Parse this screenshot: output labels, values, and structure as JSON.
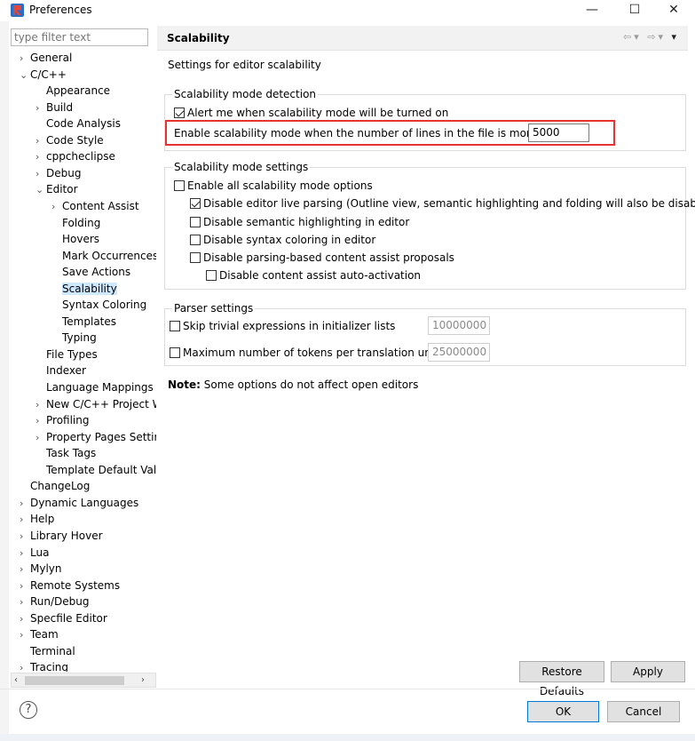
{
  "window": {
    "title": "Preferences",
    "minimize": "—",
    "maximize": "☐",
    "close": "✕"
  },
  "filter": {
    "placeholder": "type filter text"
  },
  "tree": [
    {
      "label": "General",
      "level": 0,
      "arrow": "›"
    },
    {
      "label": "C/C++",
      "level": 0,
      "arrow": "⌄"
    },
    {
      "label": "Appearance",
      "level": 1,
      "arrow": ""
    },
    {
      "label": "Build",
      "level": 1,
      "arrow": "›"
    },
    {
      "label": "Code Analysis",
      "level": 1,
      "arrow": ""
    },
    {
      "label": "Code Style",
      "level": 1,
      "arrow": "›"
    },
    {
      "label": "cppcheclipse",
      "level": 1,
      "arrow": "›"
    },
    {
      "label": "Debug",
      "level": 1,
      "arrow": "›"
    },
    {
      "label": "Editor",
      "level": 1,
      "arrow": "⌄"
    },
    {
      "label": "Content Assist",
      "level": 2,
      "arrow": "›"
    },
    {
      "label": "Folding",
      "level": 2,
      "arrow": ""
    },
    {
      "label": "Hovers",
      "level": 2,
      "arrow": ""
    },
    {
      "label": "Mark Occurrences",
      "level": 2,
      "arrow": ""
    },
    {
      "label": "Save Actions",
      "level": 2,
      "arrow": ""
    },
    {
      "label": "Scalability",
      "level": 2,
      "arrow": "",
      "selected": true
    },
    {
      "label": "Syntax Coloring",
      "level": 2,
      "arrow": ""
    },
    {
      "label": "Templates",
      "level": 2,
      "arrow": ""
    },
    {
      "label": "Typing",
      "level": 2,
      "arrow": ""
    },
    {
      "label": "File Types",
      "level": 1,
      "arrow": ""
    },
    {
      "label": "Indexer",
      "level": 1,
      "arrow": ""
    },
    {
      "label": "Language Mappings",
      "level": 1,
      "arrow": ""
    },
    {
      "label": "New C/C++ Project W",
      "level": 1,
      "arrow": "›"
    },
    {
      "label": "Profiling",
      "level": 1,
      "arrow": "›"
    },
    {
      "label": "Property Pages Settir",
      "level": 1,
      "arrow": "›"
    },
    {
      "label": "Task Tags",
      "level": 1,
      "arrow": ""
    },
    {
      "label": "Template Default Valu",
      "level": 1,
      "arrow": ""
    },
    {
      "label": "ChangeLog",
      "level": 0,
      "arrow": ""
    },
    {
      "label": "Dynamic Languages",
      "level": 0,
      "arrow": "›"
    },
    {
      "label": "Help",
      "level": 0,
      "arrow": "›"
    },
    {
      "label": "Library Hover",
      "level": 0,
      "arrow": "›"
    },
    {
      "label": "Lua",
      "level": 0,
      "arrow": "›"
    },
    {
      "label": "Mylyn",
      "level": 0,
      "arrow": "›"
    },
    {
      "label": "Remote Systems",
      "level": 0,
      "arrow": "›"
    },
    {
      "label": "Run/Debug",
      "level": 0,
      "arrow": "›"
    },
    {
      "label": "Specfile Editor",
      "level": 0,
      "arrow": "›"
    },
    {
      "label": "Team",
      "level": 0,
      "arrow": "›"
    },
    {
      "label": "Terminal",
      "level": 0,
      "arrow": ""
    },
    {
      "label": "Tracing",
      "level": 0,
      "arrow": "›"
    }
  ],
  "panel": {
    "title": "Scalability",
    "nav": {
      "back": "⇦",
      "drop1": "▾",
      "forward": "⇨",
      "drop2": "▾",
      "menu": "▾"
    },
    "description": "Settings for editor scalability",
    "detection": {
      "label": "Scalability mode detection",
      "alert_label": "Alert me when scalability mode will be turned on",
      "alert_checked": true,
      "lines_label": "Enable scalability mode when the number of lines in the file is more than:",
      "lines_value": "5000"
    },
    "settings": {
      "label": "Scalability mode settings",
      "options": [
        {
          "label": "Enable all scalability mode options",
          "checked": false
        },
        {
          "label": "Disable editor live parsing (Outline view, semantic highlighting and folding will also be disabled)",
          "checked": true
        },
        {
          "label": "Disable semantic highlighting in editor",
          "checked": false
        },
        {
          "label": "Disable syntax coloring in editor",
          "checked": false
        },
        {
          "label": "Disable parsing-based content assist proposals",
          "checked": false
        },
        {
          "label": "Disable content assist auto-activation",
          "checked": false
        }
      ]
    },
    "parser": {
      "label": "Parser settings",
      "skip_label": "Skip trivial expressions in initializer lists",
      "skip_value": "10000000",
      "tokens_label": "Maximum number of tokens per translation unit:",
      "tokens_value": "25000000"
    },
    "note_bold": "Note:",
    "note_text": " Some options do not affect open editors"
  },
  "buttons": {
    "restore_defaults": "Restore Defaults",
    "apply": "Apply",
    "ok": "OK",
    "cancel": "Cancel",
    "help": "?"
  },
  "scrollbar": {
    "left": "‹",
    "right": "›"
  }
}
